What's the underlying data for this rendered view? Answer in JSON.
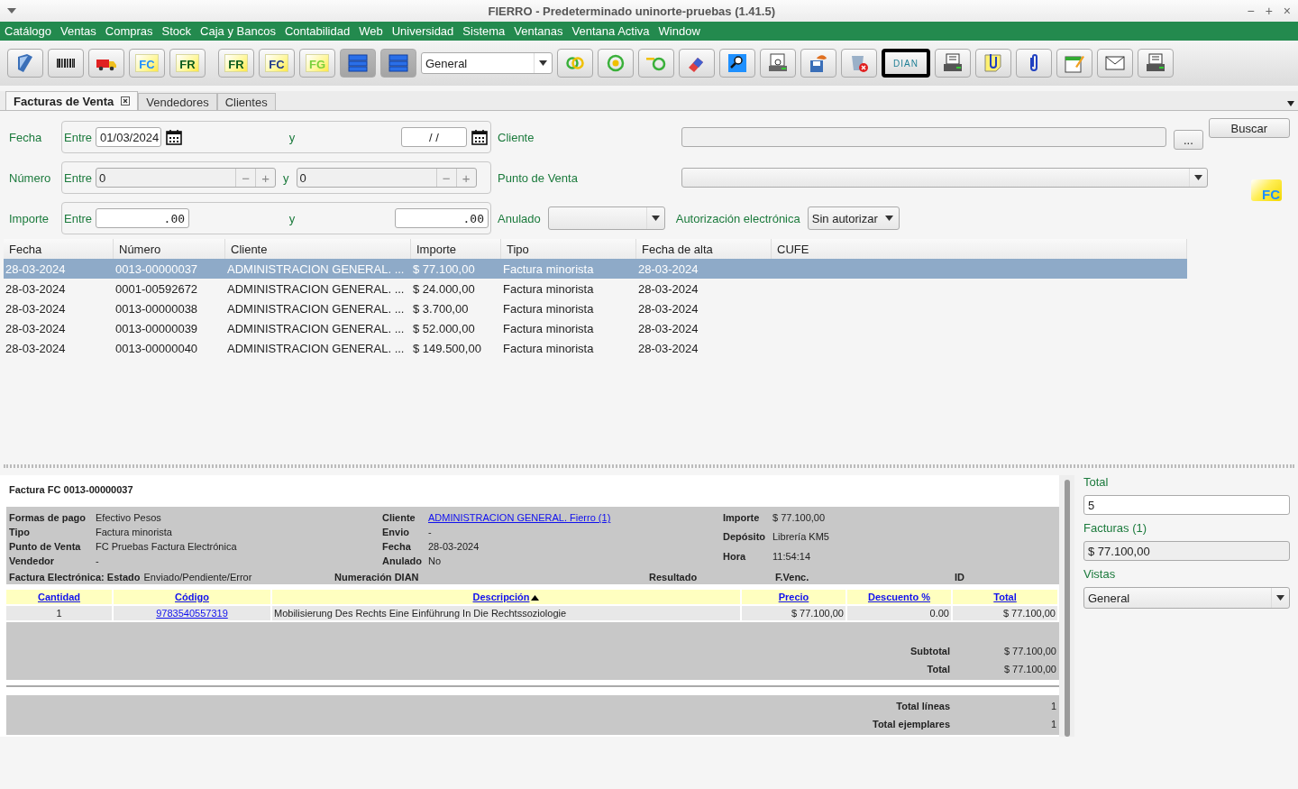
{
  "window": {
    "title": "FIERRO - Predeterminado uninorte-pruebas (1.41.5)",
    "controls": [
      "−",
      "+",
      "×"
    ]
  },
  "menu": [
    "Catálogo",
    "Ventas",
    "Compras",
    "Stock",
    "Caja y Bancos",
    "Contabilidad",
    "Web",
    "Universidad",
    "Sistema",
    "Ventanas",
    "Ventana Activa",
    "Window"
  ],
  "toolbar_groups": [
    [
      {
        "kind": "book",
        "pressed": false,
        "focused": false
      },
      {
        "kind": "barcode",
        "pressed": false,
        "focused": false
      },
      {
        "kind": "truck",
        "pressed": false,
        "focused": false
      },
      {
        "kind": "doc",
        "label": "FC",
        "color": "#1e8fff",
        "pressed": false,
        "focused": false
      },
      {
        "kind": "doc",
        "label": "FR",
        "color": "#0a5a1a",
        "pressed": false,
        "focused": false
      }
    ],
    [
      {
        "kind": "doc",
        "label": "FR",
        "color": "#0a5a1a",
        "pressed": false,
        "focused": false
      },
      {
        "kind": "doc",
        "label": "FC",
        "color": "#1f3a8a",
        "pressed": false,
        "focused": false
      },
      {
        "kind": "doc",
        "label": "FG",
        "color": "#7ad03a",
        "pressed": false,
        "focused": false
      },
      {
        "kind": "rows",
        "pressed": true,
        "focused": false
      },
      {
        "kind": "rows",
        "pressed": true,
        "focused": false
      },
      {
        "kind": "select",
        "value": "General"
      },
      {
        "kind": "rings",
        "pressed": false,
        "focused": false
      },
      {
        "kind": "target",
        "pressed": false,
        "focused": false
      },
      {
        "kind": "toggle",
        "pressed": false,
        "focused": false
      },
      {
        "kind": "eraser",
        "pressed": false,
        "focused": false
      },
      {
        "kind": "magnifier",
        "pressed": false,
        "focused": false
      },
      {
        "kind": "preview",
        "pressed": false,
        "focused": false
      },
      {
        "kind": "save",
        "pressed": false,
        "focused": false
      },
      {
        "kind": "bin",
        "pressed": false,
        "focused": false
      },
      {
        "kind": "text",
        "label": "DIAN",
        "pressed": false,
        "focused": true
      },
      {
        "kind": "printer",
        "pressed": false,
        "focused": false
      },
      {
        "kind": "note",
        "pressed": false,
        "focused": false
      },
      {
        "kind": "clip",
        "pressed": false,
        "focused": false
      },
      {
        "kind": "calendar",
        "pressed": false,
        "focused": false
      },
      {
        "kind": "envelope",
        "pressed": false,
        "focused": false
      },
      {
        "kind": "printer",
        "pressed": false,
        "focused": false
      }
    ]
  ],
  "tabs": [
    {
      "label": "Facturas de Venta",
      "selected": true,
      "closable": true
    },
    {
      "label": "Vendedores",
      "selected": false,
      "closable": false
    },
    {
      "label": "Clientes",
      "selected": false,
      "closable": false
    }
  ],
  "filters": {
    "fecha": {
      "label": "Fecha",
      "from_label": "Entre",
      "from": "01/03/2024",
      "and_label": "y",
      "to": "/ /"
    },
    "numero": {
      "label": "Número",
      "from_label": "Entre",
      "from": "0",
      "and_label": "y",
      "to": "0",
      "steppers": [
        "−",
        "+"
      ]
    },
    "importe": {
      "label": "Importe",
      "from_label": "Entre",
      "from": ".00",
      "and_label": "y",
      "to": ".00"
    },
    "cliente": {
      "label": "Cliente",
      "browse": "..."
    },
    "punto_de_venta": {
      "label": "Punto de Venta"
    },
    "anulado": {
      "label": "Anulado"
    },
    "autorizacion": {
      "label": "Autorización electrónica",
      "value": "Sin autorizar"
    },
    "search_button": "Buscar",
    "badge": "FC"
  },
  "table": {
    "columns": [
      "Fecha",
      "Número",
      "Cliente",
      "Importe",
      "Tipo",
      "Fecha de alta",
      "CUFE"
    ],
    "rows": [
      {
        "selected": true,
        "cells": [
          "28-03-2024",
          "0013-00000037",
          "ADMINISTRACION GENERAL. ...",
          "$ 77.100,00",
          "Factura minorista",
          "28-03-2024"
        ]
      },
      {
        "selected": false,
        "cells": [
          "28-03-2024",
          "0001-00592672",
          "ADMINISTRACION GENERAL. ...",
          "$ 24.000,00",
          "Factura minorista",
          "28-03-2024"
        ]
      },
      {
        "selected": false,
        "cells": [
          "28-03-2024",
          "0013-00000038",
          "ADMINISTRACION GENERAL. ...",
          "$ 3.700,00",
          "Factura minorista",
          "28-03-2024"
        ]
      },
      {
        "selected": false,
        "cells": [
          "28-03-2024",
          "0013-00000039",
          "ADMINISTRACION GENERAL. ...",
          "$ 52.000,00",
          "Factura minorista",
          "28-03-2024"
        ]
      },
      {
        "selected": false,
        "cells": [
          "28-03-2024",
          "0013-00000040",
          "ADMINISTRACION GENERAL. ...",
          "$ 149.500,00",
          "Factura minorista",
          "28-03-2024"
        ]
      }
    ]
  },
  "detail": {
    "title": "Factura FC 0013-00000037",
    "fields": [
      [
        {
          "label": "Formas de pago",
          "value": "Efectivo Pesos"
        },
        {
          "label": "Tipo",
          "value": "Factura minorista"
        },
        {
          "label": "Punto de Venta",
          "value": "FC Pruebas Factura Electrónica"
        },
        {
          "label": "Vendedor",
          "value": "-"
        }
      ],
      [
        {
          "label": "Cliente",
          "value": "ADMINISTRACION GENERAL. Fierro (1)",
          "link": true
        },
        {
          "label": "Envio",
          "value": "-"
        },
        {
          "label": "Fecha",
          "value": "28-03-2024"
        },
        {
          "label": "Anulado",
          "value": "No"
        }
      ],
      [
        {
          "label": "Importe",
          "value": "$ 77.100,00"
        },
        {
          "label": "Depósito",
          "value": "Librería KM5"
        },
        {
          "label": "Hora",
          "value": "11:54:14"
        }
      ]
    ],
    "electronic": [
      {
        "label": "Factura Electrónica: Estado",
        "value": "Enviado/Pendiente/Error"
      },
      {
        "label": "Numeración DIAN"
      },
      {
        "label": "Resultado"
      },
      {
        "label": "F.Venc."
      },
      {
        "label": "ID"
      }
    ],
    "item_columns": [
      {
        "label": "Cantidad",
        "sorted": false
      },
      {
        "label": "Código",
        "sorted": false
      },
      {
        "label": "Descripción",
        "sorted": true
      },
      {
        "label": "Precio",
        "sorted": false
      },
      {
        "label": "Descuento %",
        "sorted": false
      },
      {
        "label": "Total",
        "sorted": false
      }
    ],
    "items": [
      {
        "cells": [
          "1",
          "9783540557319",
          "Mobilisierung Des Rechts Eine Einführung In Die Rechtssoziologie",
          "$ 77.100,00",
          "0.00",
          "$ 77.100,00"
        ]
      }
    ],
    "totals": [
      {
        "label": "Subtotal",
        "value": "$ 77.100,00"
      },
      {
        "label": "Total",
        "value": "$ 77.100,00"
      }
    ],
    "summary": [
      {
        "label": "Total líneas",
        "value": "1"
      },
      {
        "label": "Total ejemplares",
        "value": "1"
      }
    ]
  },
  "side": {
    "total_label": "Total",
    "total_value": "5",
    "facturas_label": "Facturas (1)",
    "facturas_value": "$ 77.100,00",
    "vistas_label": "Vistas",
    "vistas_value": "General"
  }
}
